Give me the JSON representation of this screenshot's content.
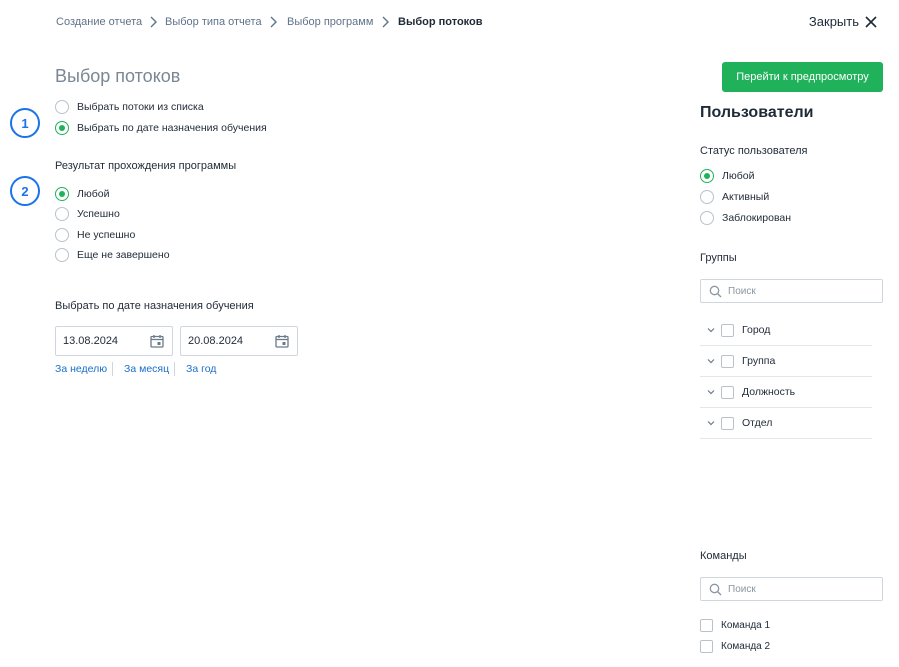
{
  "breadcrumb": {
    "items": [
      "Создание отчета",
      "Выбор типа отчета",
      "Выбор программ",
      "Выбор потоков"
    ]
  },
  "header": {
    "close_label": "Закрыть"
  },
  "main": {
    "title": "Выбор потоков",
    "markers": [
      "1",
      "2"
    ],
    "source_options": [
      {
        "label": "Выбрать потоки из списка",
        "checked": false
      },
      {
        "label": "Выбрать по дате назначения обучения",
        "checked": true
      }
    ],
    "result_label": "Результат прохождения программы",
    "result_options": [
      {
        "label": "Любой",
        "checked": true
      },
      {
        "label": "Успешно",
        "checked": false
      },
      {
        "label": "Не успешно",
        "checked": false
      },
      {
        "label": "Еще не завершено",
        "checked": false
      }
    ],
    "date_section_label": "Выбрать по дате назначения обучения",
    "date_from": "13.08.2024",
    "date_to": "20.08.2024",
    "quick_ranges": [
      "За неделю",
      "За месяц",
      "За год"
    ]
  },
  "preview_button": "Перейти к предпросмотру",
  "sidebar": {
    "title": "Пользователи",
    "status_label": "Статус пользователя",
    "status_options": [
      {
        "label": "Любой",
        "checked": true
      },
      {
        "label": "Активный",
        "checked": false
      },
      {
        "label": "Заблокирован",
        "checked": false
      }
    ],
    "groups_label": "Группы",
    "groups_search_placeholder": "Поиск",
    "groups": [
      "Город",
      "Группа",
      "Должность",
      "Отдел"
    ],
    "teams_label": "Команды",
    "teams_search_placeholder": "Поиск",
    "teams": [
      "Команда 1",
      "Команда 2"
    ]
  },
  "colors": {
    "accent": "#20b25b",
    "marker": "#1a73e8",
    "link": "#1a6fc9"
  },
  "icons": [
    "chevron-right-icon",
    "close-icon",
    "calendar-icon",
    "search-icon",
    "chevron-down-icon"
  ]
}
